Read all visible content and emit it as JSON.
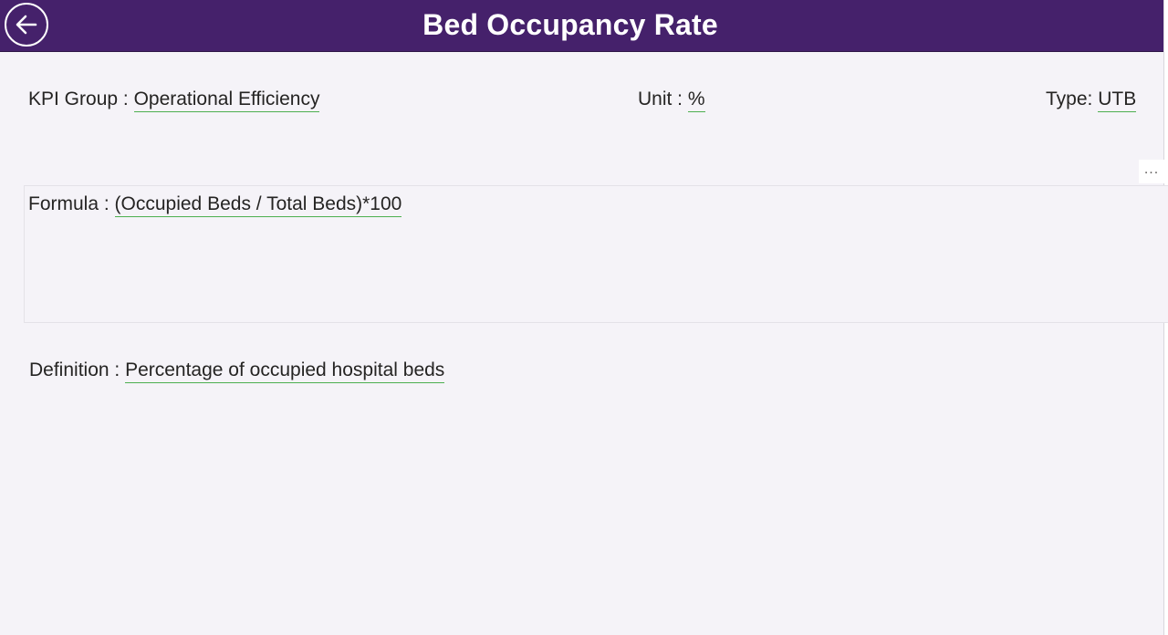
{
  "header": {
    "title": "Bed Occupancy Rate",
    "back_icon": "arrow-left-circle-icon",
    "background_color": "#45216b",
    "title_color": "#ffffff"
  },
  "kpi": {
    "group_label": "KPI Group :",
    "group_value": "Operational Efficiency",
    "unit_label": "Unit :",
    "unit_value": "%",
    "type_label": "Type:",
    "type_value": "UTB",
    "formula_label": "Formula :",
    "formula_value": "(Occupied Beds / Total Beds)*100",
    "definition_label": "Definition :",
    "definition_value": "Percentage of occupied hospital beds"
  },
  "visual_options": {
    "more_label": "...",
    "more_icon": "more-options-icon"
  },
  "accent_colors": {
    "underline": "#4caf50",
    "background": "#f5f3f8"
  }
}
